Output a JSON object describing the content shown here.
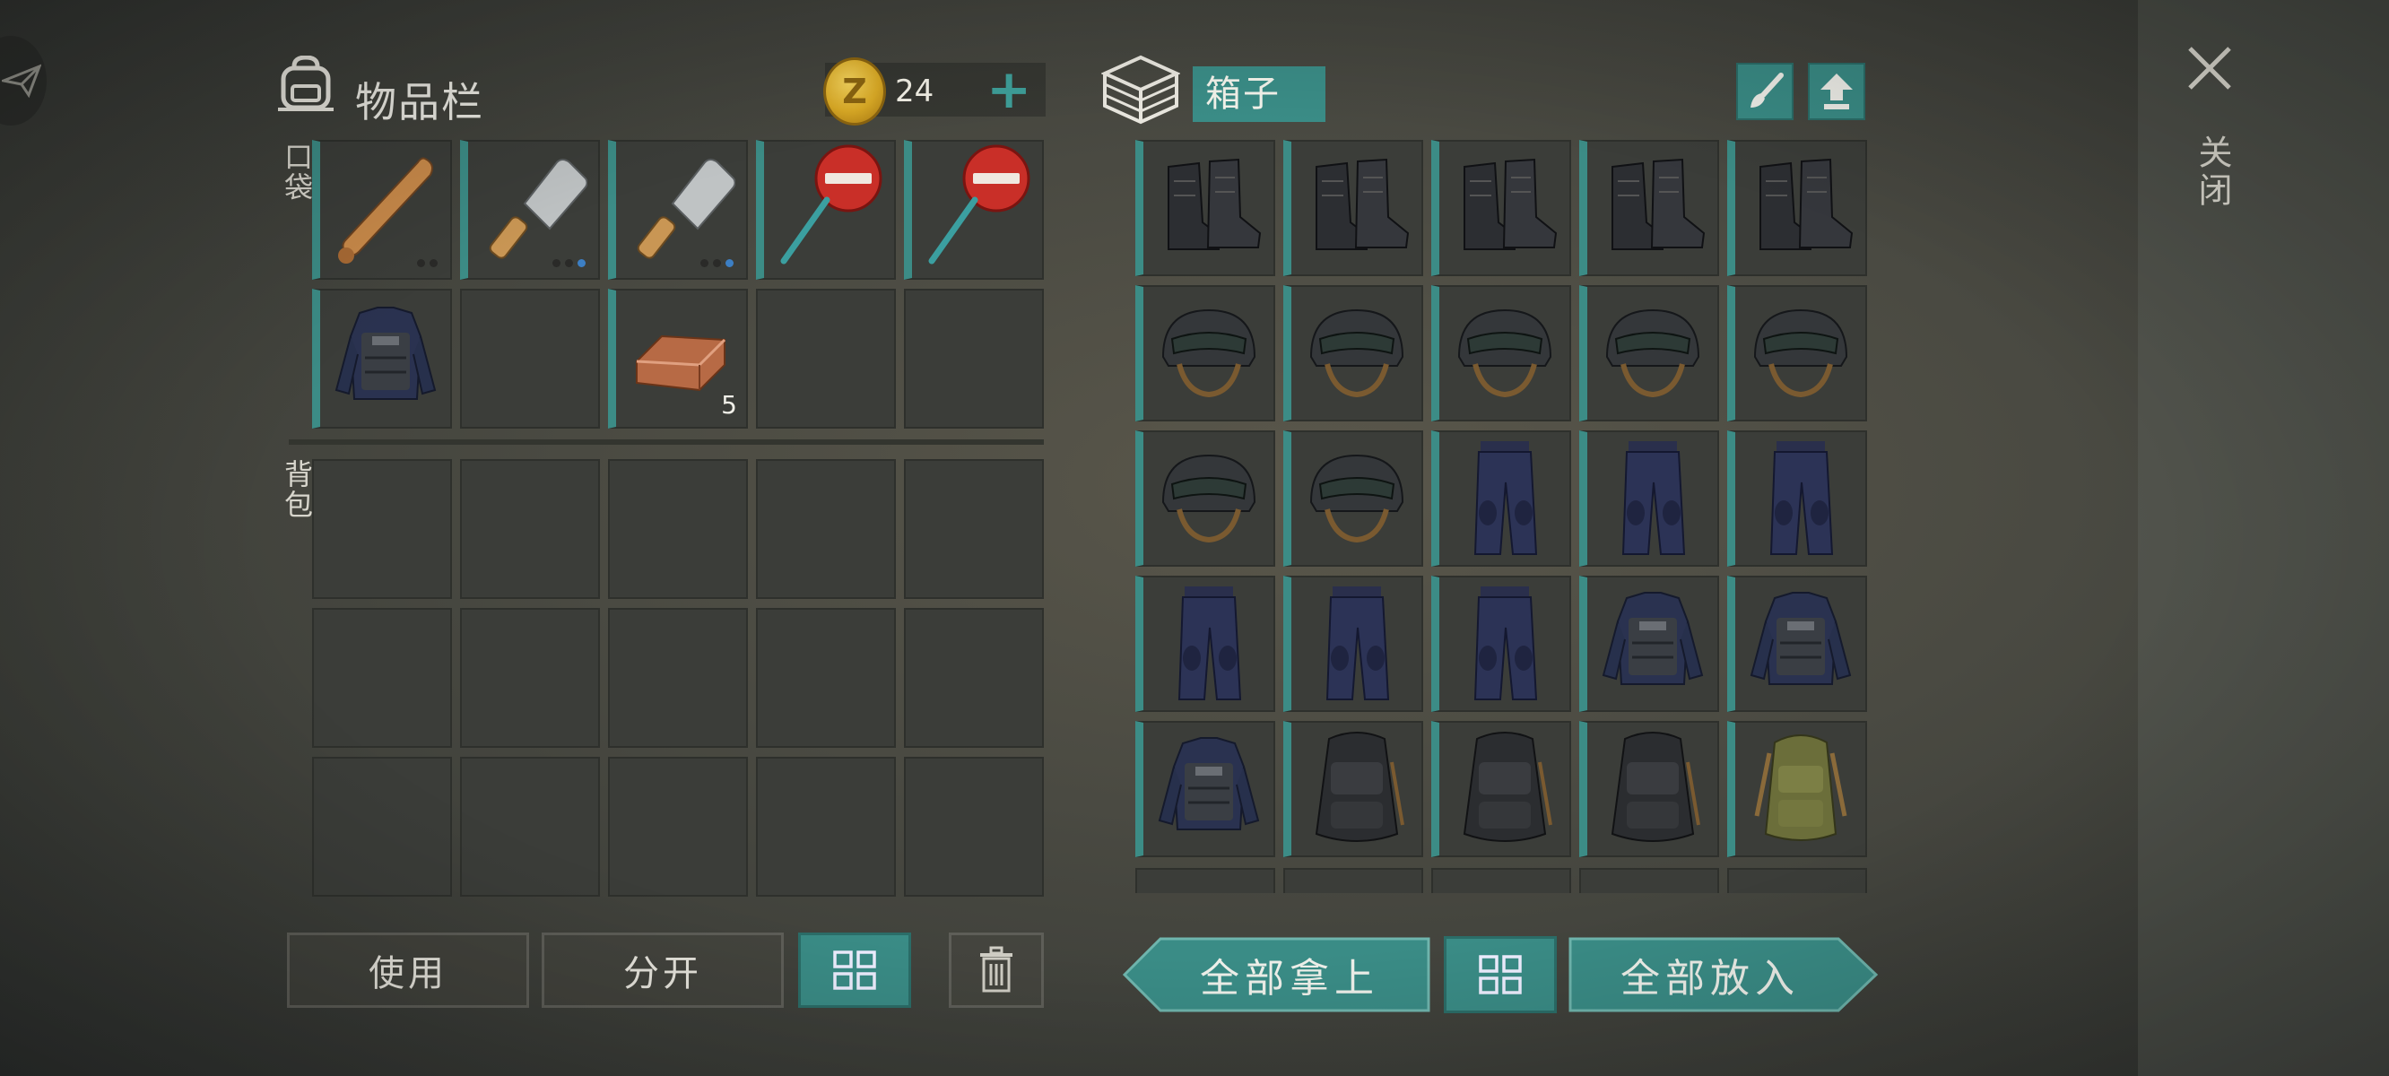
{
  "inventory": {
    "title": "物品栏",
    "coins": "24",
    "coin_symbol": "Z",
    "pockets_label": "口袋",
    "backpack_label": "背包",
    "pockets": [
      {
        "item": "baseball-bat",
        "dots": [
          "d",
          "d"
        ]
      },
      {
        "item": "cleaver",
        "dots": [
          "d",
          "d",
          "b"
        ]
      },
      {
        "item": "cleaver",
        "dots": [
          "d",
          "d",
          "b"
        ]
      },
      {
        "item": "stop-sign",
        "dots": []
      },
      {
        "item": "stop-sign",
        "dots": []
      },
      {
        "item": "police-vest",
        "dots": []
      },
      {
        "item": "",
        "dots": []
      },
      {
        "item": "copper-ingot",
        "qty": "5",
        "dots": []
      },
      {
        "item": "",
        "dots": []
      },
      {
        "item": "",
        "dots": []
      }
    ],
    "backpack_slots": 15
  },
  "actions": {
    "use": "使用",
    "split": "分开",
    "sort_icon": "grid-icon",
    "delete_icon": "trash-icon"
  },
  "box": {
    "title": "箱子",
    "items": [
      "boots",
      "boots",
      "boots",
      "boots",
      "boots",
      "helmet",
      "helmet",
      "helmet",
      "helmet",
      "helmet",
      "helmet",
      "helmet",
      "pants",
      "pants",
      "pants",
      "pants",
      "pants",
      "pants",
      "police-vest",
      "police-vest",
      "police-vest",
      "black-backpack",
      "black-backpack",
      "black-backpack",
      "green-backpack"
    ],
    "take_all": "全部拿上",
    "put_all": "全部放入"
  },
  "close_label": "关闭",
  "colors": {
    "accent": "#3a8c86",
    "slot": "#3b3d39",
    "coin": "#d9a925"
  }
}
